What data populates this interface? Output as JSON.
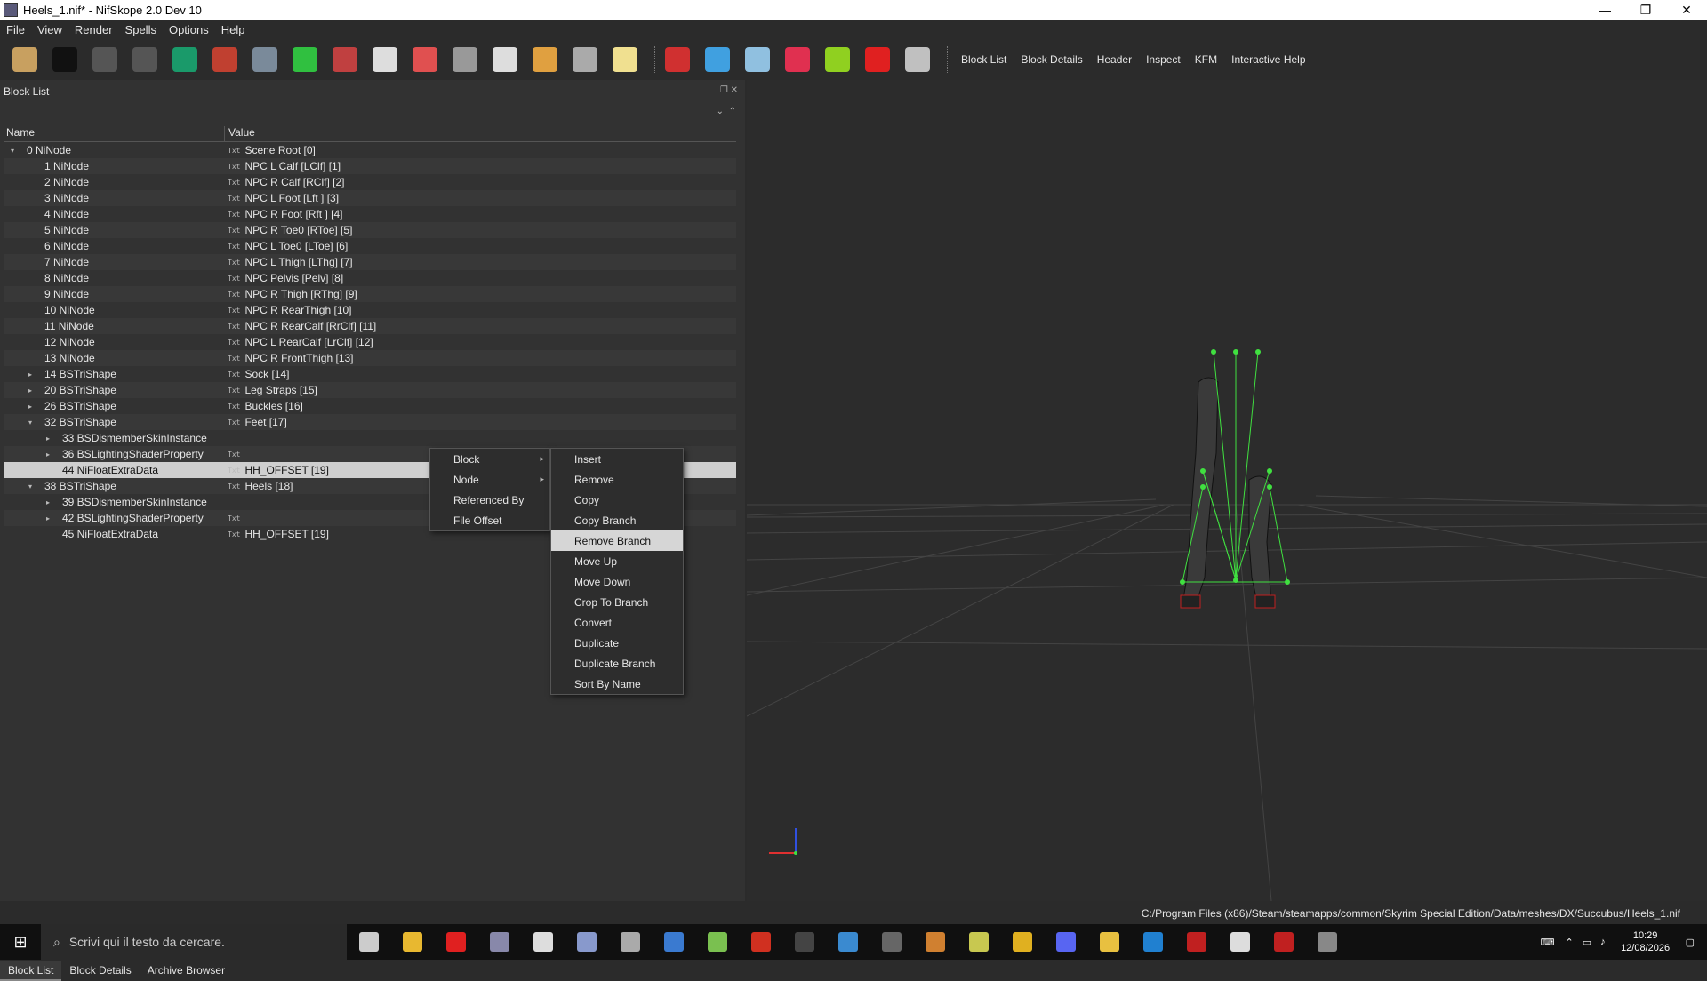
{
  "window": {
    "title": "Heels_1.nif* - NifSkope 2.0 Dev 10",
    "minimize": "—",
    "maximize": "❐",
    "close": "✕"
  },
  "menubar": [
    "File",
    "View",
    "Render",
    "Spells",
    "Options",
    "Help"
  ],
  "toolbar": {
    "icons": [
      {
        "name": "open-icon",
        "color": "#c8a060"
      },
      {
        "name": "save-icon",
        "color": "#111111"
      },
      {
        "name": "undo-icon",
        "color": "#555555"
      },
      {
        "name": "redo-icon",
        "color": "#555555"
      },
      {
        "name": "select-object-icon",
        "color": "#1a9a6a"
      },
      {
        "name": "select-vertex-icon",
        "color": "#c04030"
      },
      {
        "name": "view-cube-icon",
        "color": "#7a8a9a"
      },
      {
        "name": "view-top-icon",
        "color": "#30c040"
      },
      {
        "name": "view-side-icon",
        "color": "#c04040"
      },
      {
        "name": "view-flip-icon",
        "color": "#dddddd"
      },
      {
        "name": "view-perspective-icon",
        "color": "#e05050"
      },
      {
        "name": "walk-icon",
        "color": "#999999"
      },
      {
        "name": "eye-icon",
        "color": "#dddddd"
      },
      {
        "name": "eye-hidden-icon",
        "color": "#e0a040"
      },
      {
        "name": "screenshot-icon",
        "color": "#aaaaaa"
      },
      {
        "name": "light-icon",
        "color": "#f0e090"
      }
    ],
    "icons2": [
      {
        "name": "pin-icon",
        "color": "#d03030"
      },
      {
        "name": "axes-icon",
        "color": "#40a0e0"
      },
      {
        "name": "nodes-icon",
        "color": "#90c0e0"
      },
      {
        "name": "constraints-icon",
        "color": "#e03050"
      },
      {
        "name": "collision-icon",
        "color": "#90d020"
      },
      {
        "name": "marker-icon",
        "color": "#e02020"
      },
      {
        "name": "hidden-icon",
        "color": "#c0c0c0"
      }
    ],
    "views": [
      "Block List",
      "Block Details",
      "Header",
      "Inspect",
      "KFM",
      "Interactive Help"
    ]
  },
  "blocklist": {
    "title": "Block List",
    "col_name": "Name",
    "col_value": "Value",
    "rows": [
      {
        "name": "0 NiNode",
        "value": "Scene Root [0]",
        "exp": "▾"
      },
      {
        "name": "1 NiNode",
        "value": "NPC L Calf [LClf] [1]",
        "exp": ""
      },
      {
        "name": "2 NiNode",
        "value": "NPC R Calf [RClf] [2]",
        "exp": ""
      },
      {
        "name": "3 NiNode",
        "value": "NPC L Foot [Lft ] [3]",
        "exp": ""
      },
      {
        "name": "4 NiNode",
        "value": "NPC R Foot [Rft ] [4]",
        "exp": ""
      },
      {
        "name": "5 NiNode",
        "value": "NPC R Toe0 [RToe] [5]",
        "exp": ""
      },
      {
        "name": "6 NiNode",
        "value": "NPC L Toe0 [LToe] [6]",
        "exp": ""
      },
      {
        "name": "7 NiNode",
        "value": "NPC L Thigh [LThg] [7]",
        "exp": ""
      },
      {
        "name": "8 NiNode",
        "value": "NPC Pelvis [Pelv] [8]",
        "exp": ""
      },
      {
        "name": "9 NiNode",
        "value": "NPC R Thigh [RThg] [9]",
        "exp": ""
      },
      {
        "name": "10 NiNode",
        "value": "NPC R RearThigh [10]",
        "exp": ""
      },
      {
        "name": "11 NiNode",
        "value": "NPC R RearCalf [RrClf] [11]",
        "exp": ""
      },
      {
        "name": "12 NiNode",
        "value": "NPC L RearCalf [LrClf] [12]",
        "exp": ""
      },
      {
        "name": "13 NiNode",
        "value": "NPC R FrontThigh [13]",
        "exp": ""
      },
      {
        "name": "14 BSTriShape",
        "value": "Sock [14]",
        "exp": "▸"
      },
      {
        "name": "20 BSTriShape",
        "value": "Leg Straps [15]",
        "exp": "▸"
      },
      {
        "name": "26 BSTriShape",
        "value": "Buckles [16]",
        "exp": "▸"
      },
      {
        "name": "32 BSTriShape",
        "value": "Feet [17]",
        "exp": "▾"
      },
      {
        "name": "33 BSDismemberSkinInstance",
        "value": "",
        "exp": "▸",
        "notxt": true
      },
      {
        "name": "36 BSLightingShaderProperty",
        "value": "",
        "exp": "▸"
      },
      {
        "name": "44 NiFloatExtraData",
        "value": "HH_OFFSET [19]",
        "exp": "",
        "sel": true
      },
      {
        "name": "38 BSTriShape",
        "value": "Heels [18]",
        "exp": "▾"
      },
      {
        "name": "39 BSDismemberSkinInstance",
        "value": "",
        "exp": "▸",
        "notxt": true
      },
      {
        "name": "42 BSLightingShaderProperty",
        "value": "",
        "exp": "▸"
      },
      {
        "name": "45 NiFloatExtraData",
        "value": "HH_OFFSET [19]",
        "exp": ""
      }
    ]
  },
  "context_menu": {
    "main": [
      {
        "label": "Block",
        "arrow": "▸"
      },
      {
        "label": "Node",
        "arrow": "▸"
      },
      {
        "label": "Referenced By",
        "arrow": ""
      },
      {
        "label": "File Offset",
        "arrow": ""
      }
    ],
    "sub": [
      "Insert",
      "Remove",
      "Copy",
      "Copy Branch",
      "Remove Branch",
      "Move Up",
      "Move Down",
      "Crop To Branch",
      "Convert",
      "Duplicate",
      "Duplicate Branch",
      "Sort By Name"
    ],
    "highlighted": "Remove Branch"
  },
  "bottom_tabs": [
    "Block List",
    "Block Details",
    "Archive Browser"
  ],
  "status_path": "C:/Program Files (x86)/Steam/steamapps/common/Skyrim Special Edition/Data/meshes/DX/Succubus/Heels_1.nif",
  "taskbar": {
    "search_placeholder": "Scrivi qui il testo da cercare.",
    "apps": [
      {
        "name": "task-view-icon",
        "color": "#cccccc"
      },
      {
        "name": "file-explorer-icon",
        "color": "#e8b830"
      },
      {
        "name": "opera-icon",
        "color": "#e02020"
      },
      {
        "name": "nifskope-icon",
        "color": "#8888aa"
      },
      {
        "name": "terminal-icon",
        "color": "#dddddd"
      },
      {
        "name": "pen-icon",
        "color": "#8899cc"
      },
      {
        "name": "gears-icon",
        "color": "#aaaaaa"
      },
      {
        "name": "app-window-icon",
        "color": "#3a7ad0"
      },
      {
        "name": "notepad-icon",
        "color": "#7ac050"
      },
      {
        "name": "filezilla-icon",
        "color": "#d03020"
      },
      {
        "name": "arrow-app-icon",
        "color": "#444444"
      },
      {
        "name": "store-icon",
        "color": "#3a8ad0"
      },
      {
        "name": "calc-icon",
        "color": "#666666"
      },
      {
        "name": "gimp-icon",
        "color": "#d08030"
      },
      {
        "name": "map-icon",
        "color": "#c8c850"
      },
      {
        "name": "chrome-icon",
        "color": "#e0b020"
      },
      {
        "name": "discord-icon",
        "color": "#5865f2"
      },
      {
        "name": "folder-icon",
        "color": "#e8c040"
      },
      {
        "name": "editor-icon",
        "color": "#2080d0"
      },
      {
        "name": "fallout-icon",
        "color": "#c02020"
      },
      {
        "name": "castle-icon",
        "color": "#dddddd"
      },
      {
        "name": "game-icon",
        "color": "#c02020"
      },
      {
        "name": "skyrim-icon",
        "color": "#888888"
      }
    ],
    "time": "10:29",
    "date": "12/08/2026"
  }
}
